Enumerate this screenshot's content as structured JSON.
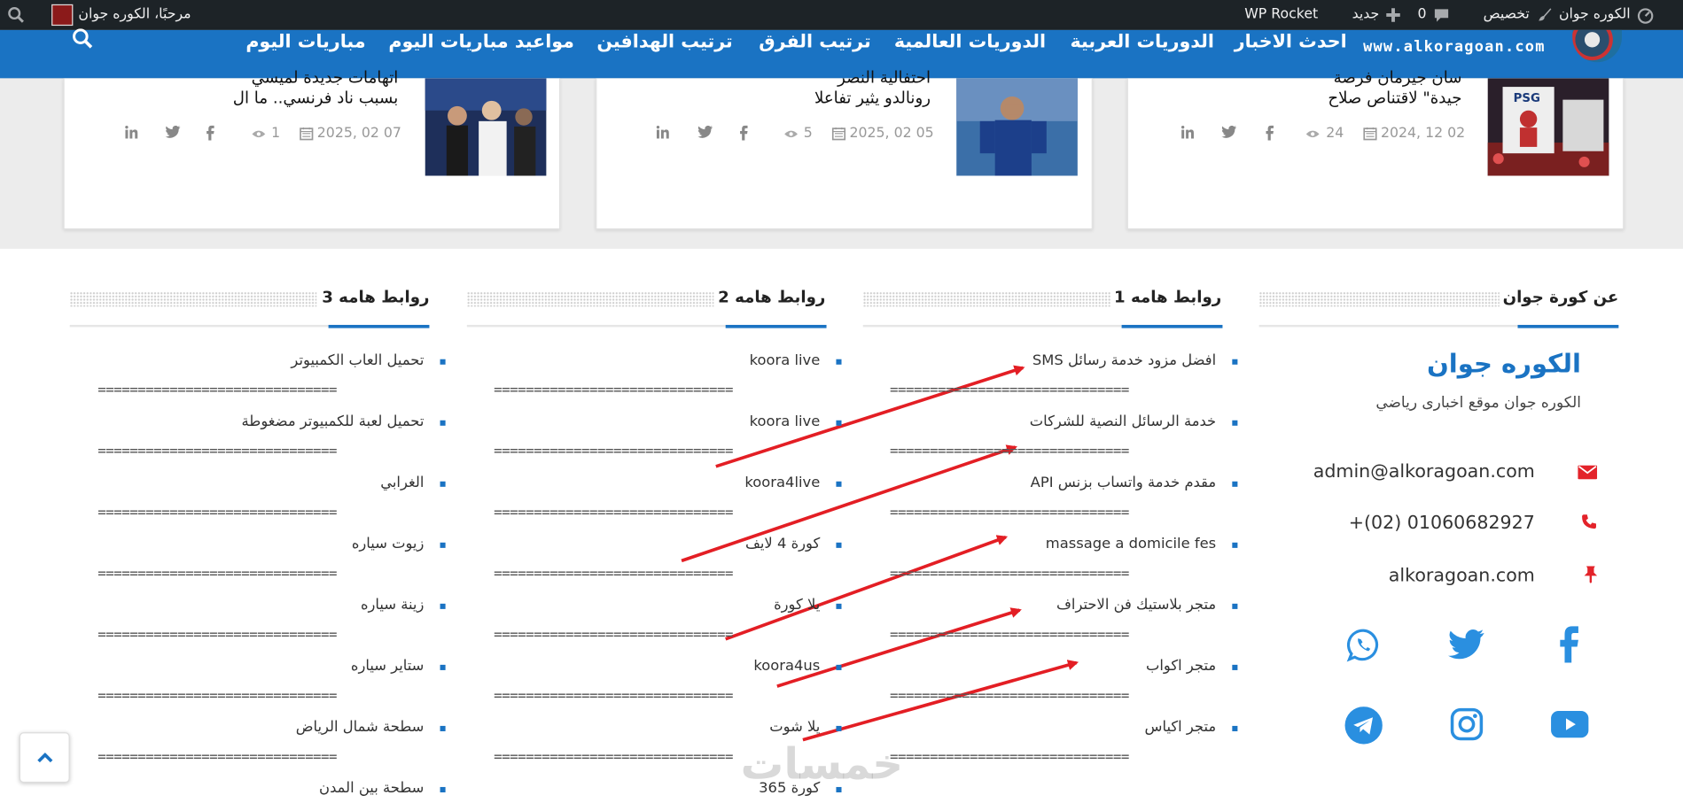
{
  "admin_bar": {
    "site_name": "الكوره جوان",
    "customize": "تخصيص",
    "comments_count": "0",
    "new_label": "جديد",
    "plugin": "WP Rocket",
    "greeting": "مرحبًا، الكوره جوان",
    "icons": [
      "dashboard-icon",
      "brush-icon",
      "comment-icon",
      "plus-icon",
      "avatar",
      "search-icon"
    ]
  },
  "nav": {
    "logo_url_text": "www.alkoragoan.com",
    "items": [
      "احدث الاخبار",
      "الدوريات العربية",
      "الدوريات العالمية",
      "ترتيب الفرق",
      "ترتيب الهدافين",
      "مواعيد مباريات اليوم",
      "مباريات اليوم"
    ]
  },
  "cards": [
    {
      "title_line1": "بسبب ناد فرنسي.. ما ال",
      "title_line0": "اتهامات جديدة لميسي",
      "date": "2025, 02 07",
      "views": "1"
    },
    {
      "title_line1": "رونالدو يثير تفاعلا",
      "title_line0": "احتفالية النصر",
      "date": "2025, 02 05",
      "views": "5"
    },
    {
      "title_line1": "جيدة\" لاقتناص صلاح",
      "title_line0": "سان جيرمان فرصة",
      "date": "2024, 12 02",
      "views": "24"
    }
  ],
  "about": {
    "heading": "عن كورة جوان",
    "name": "الكوره جوان",
    "description": "الكوره جوان موقع اخبارى رياضي",
    "email": "admin@alkoragoan.com",
    "phone": "+(02) 01060682927",
    "website": "alkoragoan.com",
    "colors": {
      "accent": "#1a73c3",
      "contact_icon": "#e3232a",
      "social": "#2a8fe0"
    }
  },
  "links1": {
    "heading": "روابط هامه 1",
    "items": [
      "افضل مزود خدمة رسائل SMS",
      "خدمة الرسائل النصية للشركات",
      "مقدم خدمة واتساب بزنس API",
      "massage a domicile fes",
      "متجر بلاستيك فن الاحتراف",
      "متجر اكواب",
      "متجر اكياس"
    ]
  },
  "links2": {
    "heading": "روابط هامه 2",
    "items": [
      "koora live",
      "koora live",
      "koora4live",
      "كورة 4 لايف",
      "يلا كورة",
      "koora4us",
      "يلا شوت",
      "كورة 365"
    ]
  },
  "links3": {
    "heading": "روابط هامه 3",
    "items": [
      "تحميل العاب الكمبيوتر",
      "تحميل لعبة للكمبيوتر مضغوطة",
      "الغرابي",
      "زيوت سياره",
      "زينة سياره",
      "ستاير سياره",
      "سطحة شمال الرياض",
      "سطحة بين المدن"
    ]
  },
  "separator": "==============================",
  "watermark": "خمسات"
}
